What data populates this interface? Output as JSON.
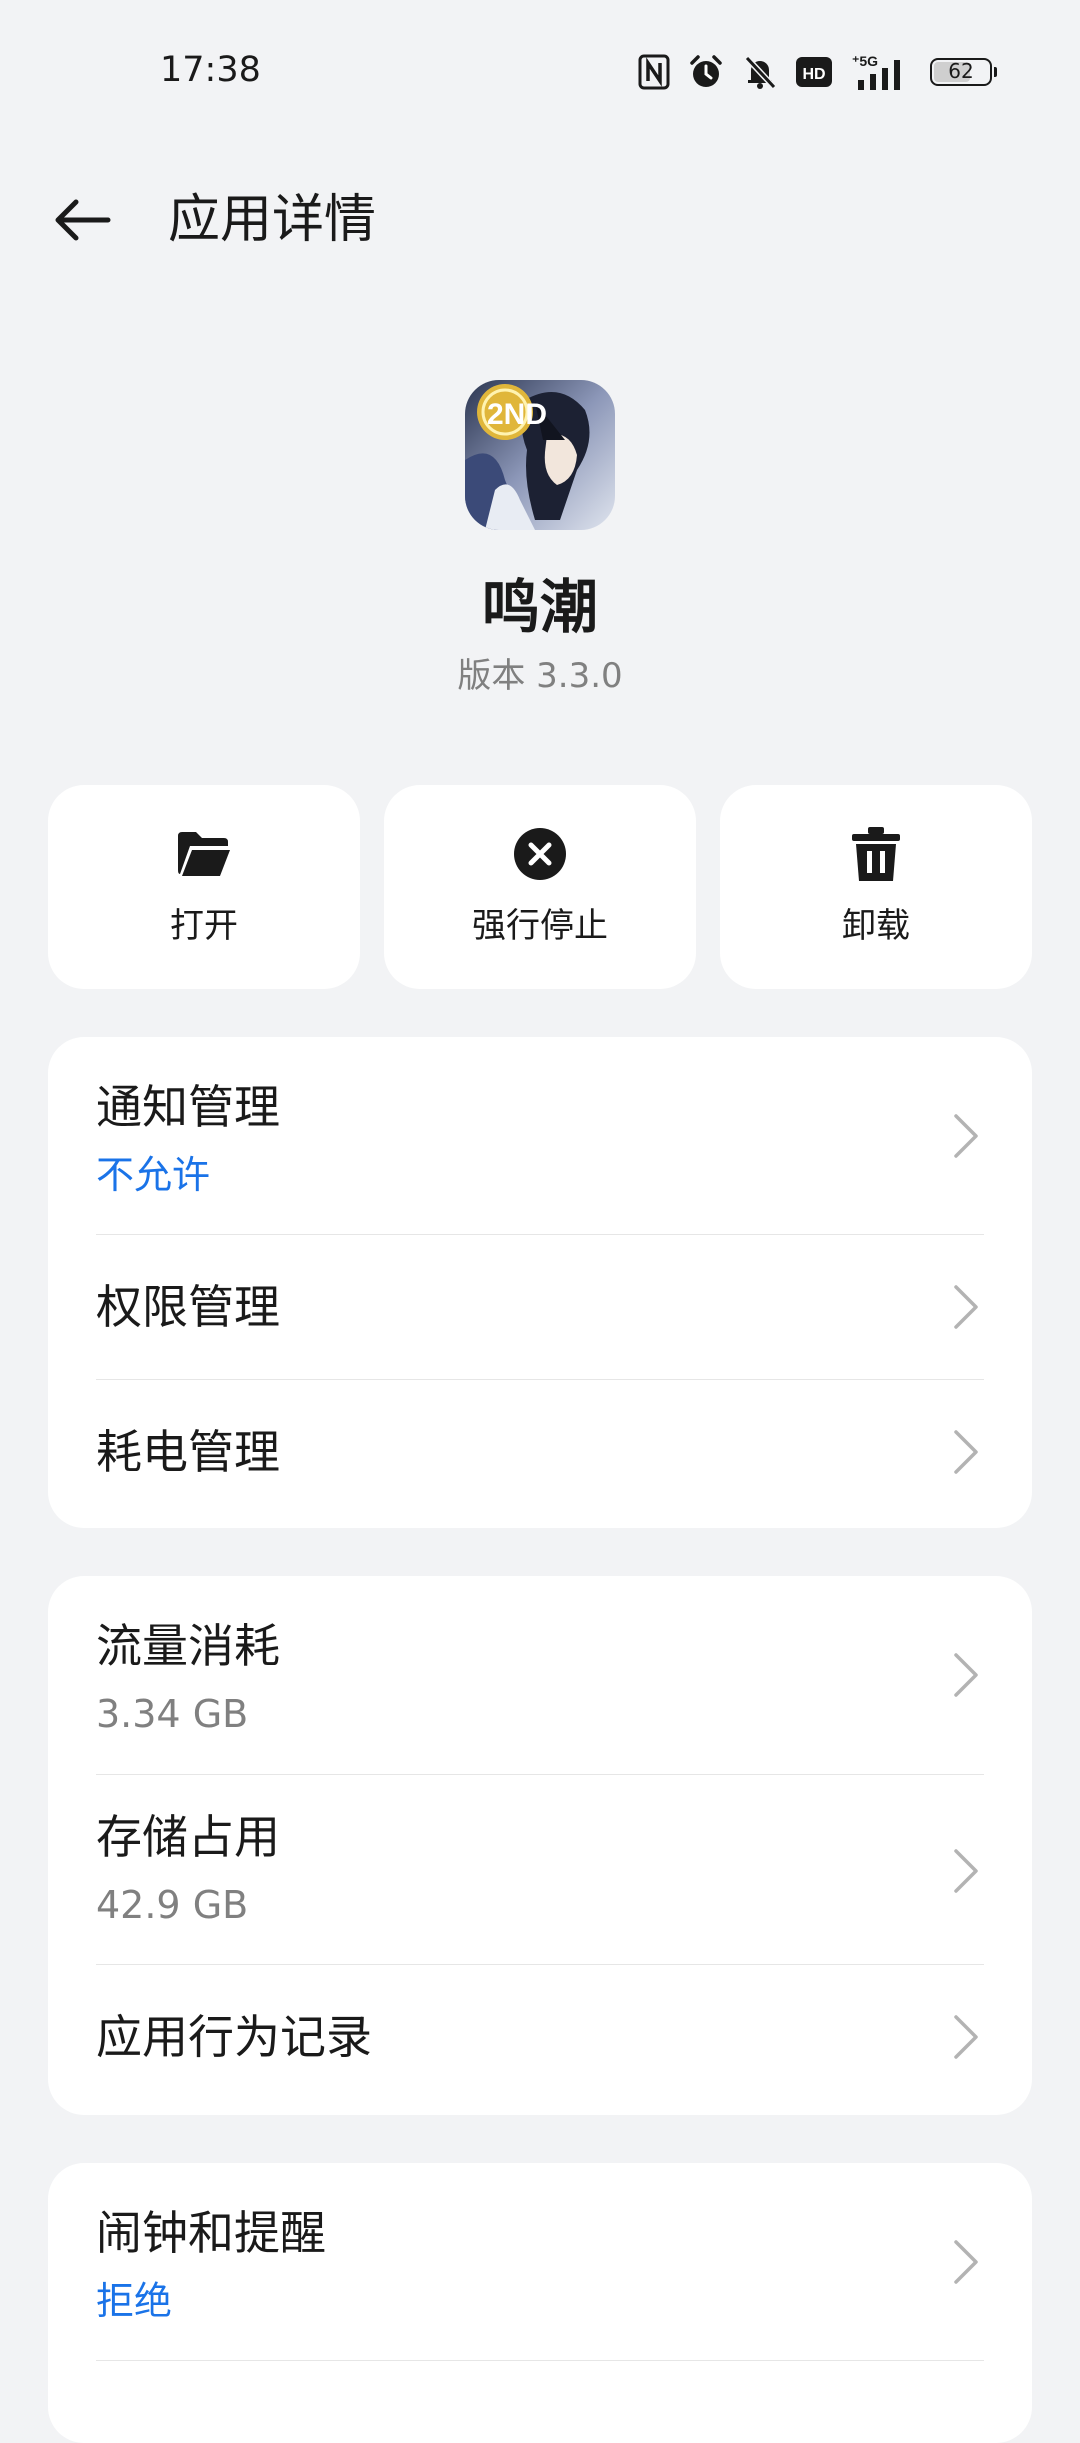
{
  "status_bar": {
    "time": "17:38",
    "battery_level": "62",
    "icons": [
      "nfc-icon",
      "alarm-icon",
      "mute-icon",
      "hd-icon",
      "5g-signal-icon",
      "battery-icon"
    ]
  },
  "header": {
    "title": "应用详情"
  },
  "app": {
    "name": "鸣潮",
    "version": "版本 3.3.0",
    "icon_badge": "2ND"
  },
  "actions": [
    {
      "label": "打开",
      "icon": "folder-icon"
    },
    {
      "label": "强行停止",
      "icon": "close-circle-icon"
    },
    {
      "label": "卸载",
      "icon": "trash-icon"
    }
  ],
  "cards": {
    "management": [
      {
        "title": "通知管理",
        "subtitle": "不允许"
      },
      {
        "title": "权限管理"
      },
      {
        "title": "耗电管理"
      }
    ],
    "usage": [
      {
        "title": "流量消耗",
        "subtitle": "3.34 GB"
      },
      {
        "title": "存储占用",
        "subtitle": "42.9 GB"
      },
      {
        "title": "应用行为记录"
      }
    ],
    "alarms": [
      {
        "title": "闹钟和提醒",
        "subtitle": "拒绝"
      }
    ]
  },
  "colors": {
    "background": "#f2f3f5",
    "card": "#ffffff",
    "accent_blue": "#1a73e8",
    "secondary_text": "#808080"
  }
}
